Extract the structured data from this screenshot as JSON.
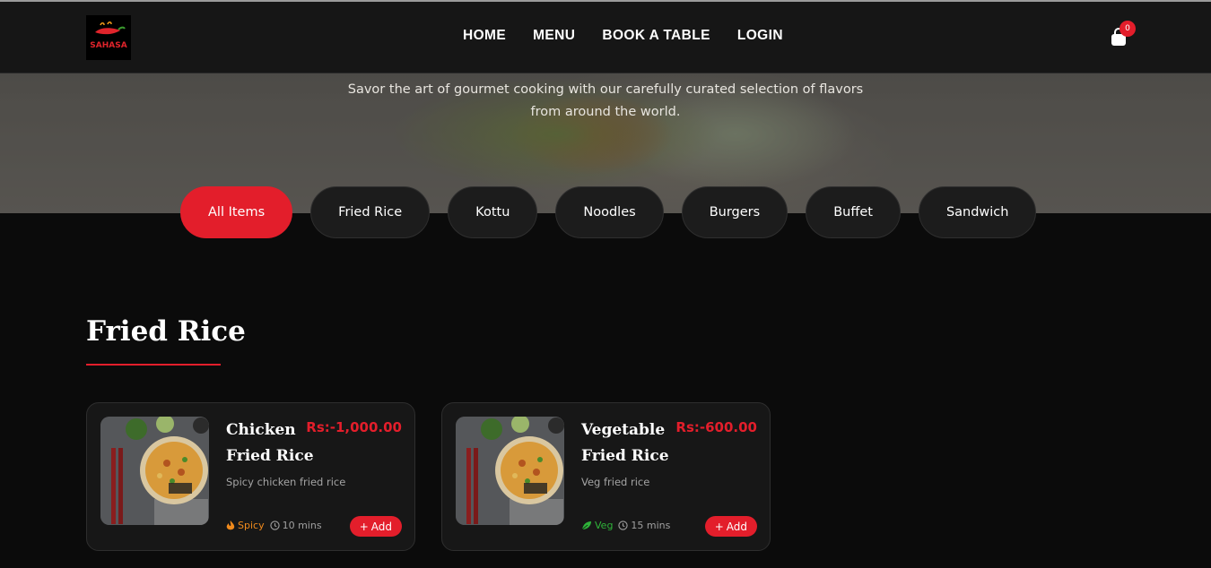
{
  "brand": {
    "logo_text": "SAHASA"
  },
  "nav": {
    "items": [
      {
        "label": "HOME"
      },
      {
        "label": "MENU"
      },
      {
        "label": "BOOK A TABLE"
      },
      {
        "label": "LOGIN"
      }
    ]
  },
  "cart": {
    "count": "0"
  },
  "hero": {
    "tagline": "Savor the art of gourmet cooking with our carefully curated selection of flavors from around the world."
  },
  "filters": {
    "items": [
      {
        "label": "All Items",
        "active": true
      },
      {
        "label": "Fried Rice",
        "active": false
      },
      {
        "label": "Kottu",
        "active": false
      },
      {
        "label": "Noodles",
        "active": false
      },
      {
        "label": "Burgers",
        "active": false
      },
      {
        "label": "Buffet",
        "active": false
      },
      {
        "label": "Sandwich",
        "active": false
      }
    ]
  },
  "section": {
    "title": "Fried Rice"
  },
  "cards": [
    {
      "name": "Chicken Fried Rice",
      "price": "Rs:-1,000.00",
      "description": "Spicy chicken fried rice",
      "flavor": "Spicy",
      "flavor_icon": "flame-icon",
      "flavor_color": "#f08a1c",
      "time": "10 mins",
      "add_label": "Add"
    },
    {
      "name": "Vegetable Fried Rice",
      "price": "Rs:-600.00",
      "description": "Veg fried rice",
      "flavor": "Veg",
      "flavor_icon": "leaf-icon",
      "flavor_color": "#2fb33a",
      "time": "15 mins",
      "add_label": "Add"
    }
  ],
  "colors": {
    "accent": "#e31e2b",
    "background": "#0b0b0b",
    "card": "#171717"
  }
}
